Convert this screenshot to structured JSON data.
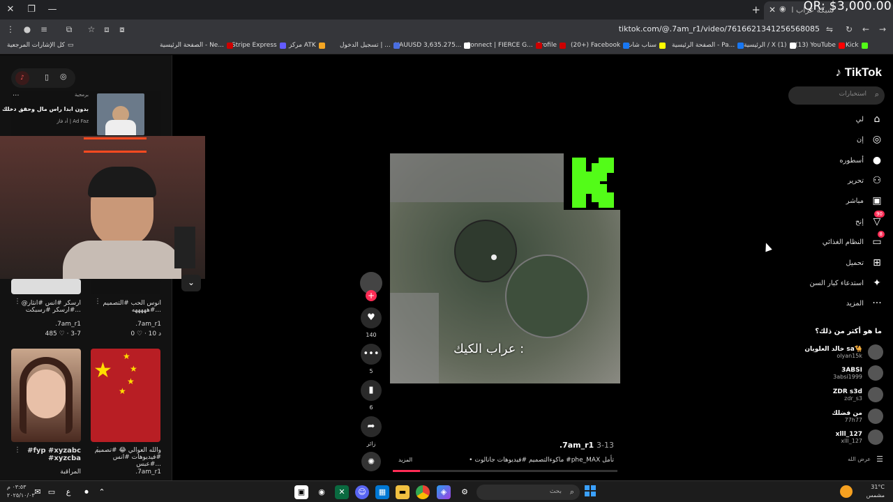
{
  "browser": {
    "tab_title": "شبكة عراب القوت",
    "overlay_price": "QR: $3,000.00",
    "url": "tiktok.com/@.7am_r1/video/7616621341256568085",
    "new_tab": "+",
    "bookmarks_folder": "كل الإشارات المرجعية",
    "bookmarks": [
      {
        "label": "Kick",
        "color": "#53fc18"
      },
      {
        "label": "(13) YouTube",
        "color": "#ff0000"
      },
      {
        "label": "الرئيسية / X (1)",
        "color": "#ffffff"
      },
      {
        "label": "الصفحة الرئيسية - Pa...",
        "color": "#1877f2"
      },
      {
        "label": "سناب شات",
        "color": "#fffc00"
      },
      {
        "label": "(20+) Facebook",
        "color": "#1877f2"
      },
      {
        "label": "Profile",
        "color": "#cc0000"
      },
      {
        "label": "Connect | FIERCE G...",
        "color": "#cc0000"
      },
      {
        "label": "XAUUSD 3,635.275...",
        "color": "#ffffff"
      },
      {
        "label": "تسجيل الدخول | ...",
        "color": "#4a6ee0"
      },
      {
        "label": "مركز ATK",
        "color": "#f5a623"
      },
      {
        "label": "Stripe Express",
        "color": "#635bff"
      },
      {
        "label": "الصفحة الرئيسية - Ne...",
        "color": "#cc0000"
      }
    ]
  },
  "tiktok": {
    "logo": "TikTok",
    "search_placeholder": "استخبارات",
    "nav": [
      {
        "label": "لي",
        "icon": "home-icon",
        "glyph": "⌂"
      },
      {
        "label": "إن",
        "icon": "compass-icon",
        "glyph": "◎"
      },
      {
        "label": "أسطوره",
        "icon": "avatar-icon",
        "glyph": "●"
      },
      {
        "label": "تحرير",
        "icon": "people-icon",
        "glyph": "⚇"
      },
      {
        "label": "مباشر",
        "icon": "live-icon",
        "glyph": "▣"
      },
      {
        "label": "إنح",
        "icon": "explore-icon",
        "glyph": "▽",
        "badge": "90"
      },
      {
        "label": "النظام الغذائي",
        "icon": "messages-icon",
        "glyph": "▭",
        "badge": "8"
      },
      {
        "label": "تحميل",
        "icon": "upload-icon",
        "glyph": "⊞"
      },
      {
        "label": "استدعاء كبار السن",
        "icon": "effects-icon",
        "glyph": "✦"
      },
      {
        "label": "المزيد",
        "icon": "more-icon",
        "glyph": "···"
      }
    ],
    "suggest_title": "ما هو أكثر من ذلك؟",
    "suggestions": [
      {
        "name": "خالد العلويان sa🐪",
        "handle": "olyan15k"
      },
      {
        "name": "3ABSI",
        "handle": "3absi1999"
      },
      {
        "name": "ZDR s3d",
        "handle": "zdr_s3"
      },
      {
        "name": "من فضلك",
        "handle": "77h77"
      },
      {
        "name": "xlll_127",
        "handle": "xlll_127"
      }
    ],
    "see_all": "عرض الله",
    "video": {
      "caption": "عراب الكيك :",
      "author": ".7am_r1",
      "date": "3-13",
      "description": "• ماكوءالتصميم #فيديوهات جانالوت #phe_MAX تأمل",
      "more": "المزيد",
      "likes": "140",
      "comments": "5",
      "saves": "6",
      "shares": "زائر",
      "progress": 0.12
    },
    "left": {
      "ad_sponsored": "برمجية",
      "ad_title": "بدون ابدا راس مال وحقق دخلك",
      "ad_source": "أد فاز | Ad Faz",
      "cards": [
        {
          "title": "@ارسكر #انس #انثار #ارسكر #رسبكت...",
          "author": ".7am_r1",
          "stats": "485 ♡ · 3-7"
        },
        {
          "title": "انوس الحب #التصميم #هههههه...",
          "author": ".7am_r1",
          "stats": "0 ♡ · 10 د"
        },
        {
          "title": "#fyp #xyzabc #xyzcba",
          "author": "المراقبة",
          "stats": ""
        },
        {
          "title": "والله العوالي 😂 #تصميم #فيديوهات #انس #عبس...",
          "author": ".7am_r1",
          "stats": ""
        }
      ]
    }
  },
  "taskbar": {
    "search_placeholder": "بحث",
    "time": "٠٣:٥٣ م",
    "date": "٢٠٢٥/١٠/٠٣",
    "lang": "ع",
    "temp": "31°C",
    "weather": "مشمس"
  }
}
